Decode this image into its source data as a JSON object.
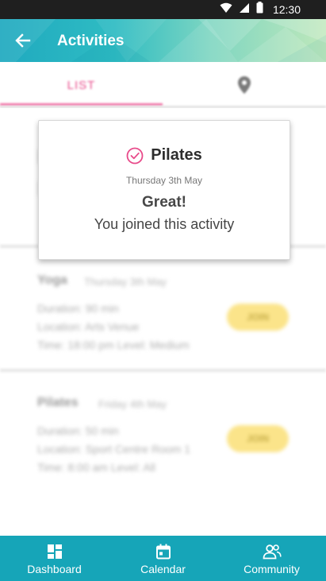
{
  "status_bar": {
    "time": "12:30"
  },
  "app_bar": {
    "title": "Activities"
  },
  "tabs": {
    "list_label": "LIST"
  },
  "activities": [
    {
      "name": "Yoga",
      "date": "Thursday 3th May",
      "duration": "Duration: 90 min",
      "location": "Location: Arts Venue",
      "time_level": "Time: 18:00 pm  Level: Medium",
      "join_label": "JOIN"
    },
    {
      "name": "Pilates",
      "date": "Friday 4th May",
      "duration": "Duration: 50 min",
      "location": "Location: Sport Centre Room 1",
      "time_level": "Time: 8:00 am  Level: All",
      "join_label": "JOIN"
    }
  ],
  "dialog": {
    "activity_name": "Pilates",
    "date": "Thursday 3th May",
    "headline": "Great!",
    "message": "You joined this activity"
  },
  "bottom_nav": [
    {
      "label": "Dashboard",
      "icon": "dashboard-icon"
    },
    {
      "label": "Calendar",
      "icon": "calendar-icon"
    },
    {
      "label": "Community",
      "icon": "community-icon"
    }
  ],
  "colors": {
    "accent_pink": "#e84a8a",
    "nav_teal": "#16a5b8",
    "join_yellow": "#fbe48a"
  }
}
